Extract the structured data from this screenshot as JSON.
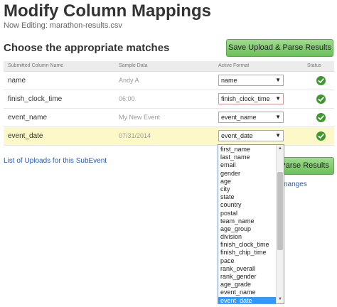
{
  "header": {
    "title": "Modify Column Mappings",
    "subtitle": "Now Editing: marathon-results.csv"
  },
  "section": {
    "title": "Choose the appropriate matches"
  },
  "toolbar": {
    "save_label": "Save Upload & Parse Results",
    "save_label_2": "Save Upload & Parse Results"
  },
  "table": {
    "headers": [
      "Submitted Column Name",
      "Sample Data",
      "Active Format",
      "Status"
    ],
    "rows": [
      {
        "name": "name",
        "sample": "Andy A",
        "format": "name",
        "status": "check-icon"
      },
      {
        "name": "finish_clock_time",
        "sample": "06:00",
        "format": "finish_clock_time",
        "status": "check-icon"
      },
      {
        "name": "event_name",
        "sample": "My New Event",
        "format": "event_name",
        "status": "check-icon"
      },
      {
        "name": "event_date",
        "sample": "07/31/2014",
        "format": "event_date",
        "status": "check-icon"
      }
    ]
  },
  "links": {
    "uploads": "List of Uploads for this SubEvent",
    "changes": "nanges"
  },
  "dropdown": {
    "options": [
      "first_name",
      "last_name",
      "email",
      "gender",
      "age",
      "city",
      "state",
      "country",
      "postal",
      "team_name",
      "age_group",
      "division",
      "finish_clock_time",
      "finish_chip_time",
      "pace",
      "rank_overall",
      "rank_gender",
      "age_grade",
      "event_name",
      "event_date"
    ],
    "selected": "event_date"
  },
  "colors": {
    "accent_green": "#6cbf5a",
    "check_green": "#3a9a2a",
    "highlight_row": "#fcf8c8",
    "link_blue": "#2a5db0",
    "selected_option": "#3399ff"
  }
}
